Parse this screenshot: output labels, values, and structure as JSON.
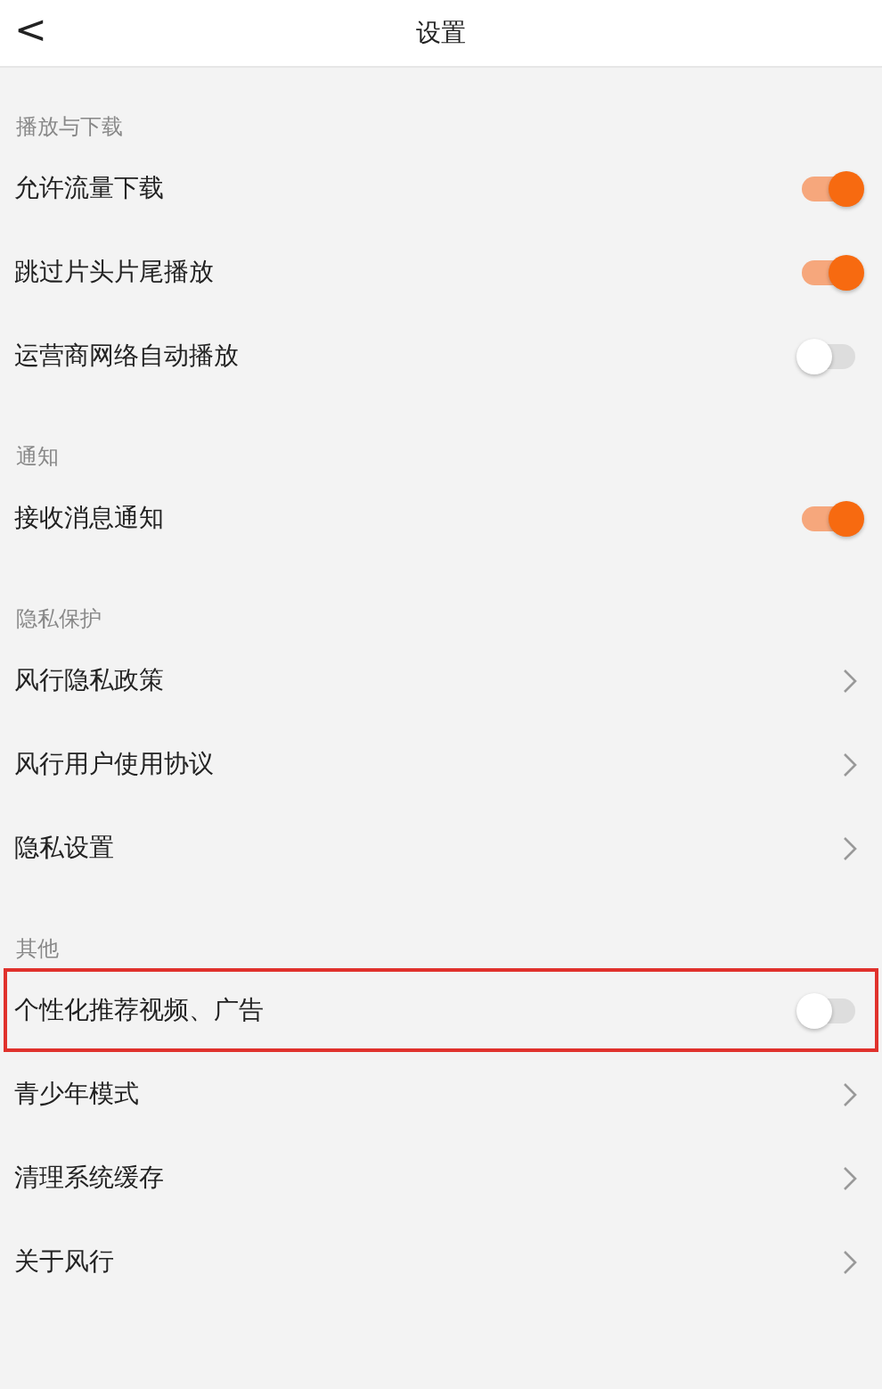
{
  "header": {
    "back": "<",
    "title": "设置"
  },
  "sections": [
    {
      "title": "播放与下载",
      "items": [
        {
          "kind": "toggle",
          "label": "允许流量下载",
          "on": true,
          "highlighted": false
        },
        {
          "kind": "toggle",
          "label": "跳过片头片尾播放",
          "on": true,
          "highlighted": false
        },
        {
          "kind": "toggle",
          "label": "运营商网络自动播放",
          "on": false,
          "highlighted": false
        }
      ]
    },
    {
      "title": "通知",
      "items": [
        {
          "kind": "toggle",
          "label": "接收消息通知",
          "on": true,
          "highlighted": false
        }
      ]
    },
    {
      "title": "隐私保护",
      "items": [
        {
          "kind": "link",
          "label": "风行隐私政策",
          "highlighted": false
        },
        {
          "kind": "link",
          "label": "风行用户使用协议",
          "highlighted": false
        },
        {
          "kind": "link",
          "label": "隐私设置",
          "highlighted": false
        }
      ]
    },
    {
      "title": "其他",
      "items": [
        {
          "kind": "toggle",
          "label": "个性化推荐视频、广告",
          "on": false,
          "highlighted": true
        },
        {
          "kind": "link",
          "label": "青少年模式",
          "highlighted": false
        },
        {
          "kind": "link",
          "label": "清理系统缓存",
          "highlighted": false
        },
        {
          "kind": "link",
          "label": "关于风行",
          "highlighted": false
        }
      ]
    }
  ]
}
